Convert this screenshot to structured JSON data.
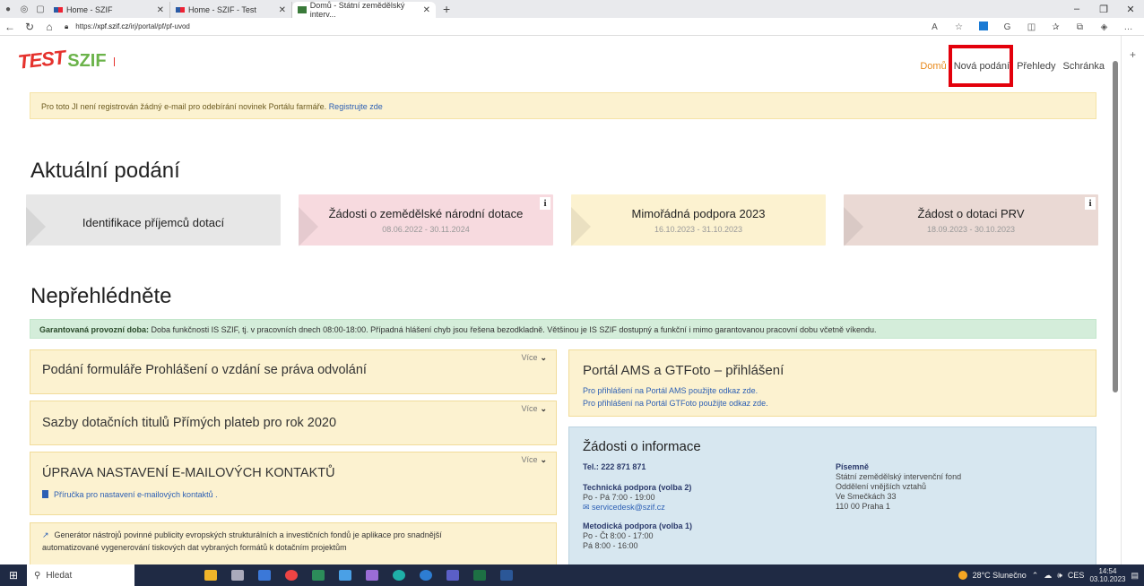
{
  "browser": {
    "tabs": [
      {
        "label": "Home - SZIF"
      },
      {
        "label": "Home - SZIF - Test"
      },
      {
        "label": "Domů - Státní zemědělský interv..."
      }
    ],
    "url": "https://",
    "url_host": "xpf.szif.cz",
    "url_path": "/irj/portal/pf/pf-uvod"
  },
  "header": {
    "logo_test": "TEST",
    "logo_szif": "SZIF",
    "nav": [
      {
        "label": "Domů",
        "active": true
      },
      {
        "label": "Nová podání"
      },
      {
        "label": "Přehledy"
      },
      {
        "label": "Schránka"
      }
    ]
  },
  "alert": {
    "text": "Pro toto JI není registrován žádný e-mail pro odebírání novinek Portálu farmáře.",
    "link": "Registrujte zde"
  },
  "aktualni": {
    "title": "Aktuální podání",
    "cards": [
      {
        "title": "Identifikace příjemců dotací",
        "date": "",
        "color": "#e7e7e7",
        "info": false
      },
      {
        "title": "Žádosti o zemědělské národní dotace",
        "date": "08.06.2022 - 30.11.2024",
        "color": "#f7dadf",
        "info": true
      },
      {
        "title": "Mimořádná podpora 2023",
        "date": "16.10.2023 - 31.10.2023",
        "color": "#fcf2d0",
        "info": false
      },
      {
        "title": "Žádost o dotaci PRV",
        "date": "18.09.2023 - 30.10.2023",
        "color": "#ead9d4",
        "info": true
      }
    ]
  },
  "neprehlednete": {
    "title": "Nepřehlédněte",
    "notice_bold": "Garantovaná provozní doba:",
    "notice": "Doba funkčnosti IS SZIF, tj. v pracovních dnech 08:00-18:00. Případná hlášení chyb jsou řešena bezodkladně. Většinou je IS SZIF dostupný a funkční i mimo garantovanou pracovní dobu včetně víkendu.",
    "more": "Více",
    "box1": "Podání formuláře Prohlášení o vzdání se práva odvolání",
    "box2": "Sazby dotačních titulů Přímých plateb pro rok 2020",
    "box3": "ÚPRAVA NASTAVENÍ E-MAILOVÝCH KONTAKTŮ",
    "box3_link": "Příručka pro nastavení e-mailových kontaktů .",
    "box4_line1": "Generátor nástrojů povinné publicity evropských strukturálních a investičních fondů je aplikace pro snadnější",
    "box4_line2": "automatizované vygenerování tiskových dat vybraných formátů k dotačním projektům",
    "ams_title": "Portál AMS a GTFoto – přihlášení",
    "ams_l1": "Pro přihlášení na Portál AMS použijte odkaz zde.",
    "ams_l2": "Pro přihlášení na Portál GTFoto použijte odkaz zde.",
    "info_title": "Žádosti o informace",
    "tel": "Tel.: 222 871 871",
    "tech_title": "Technická podpora (volba 2)",
    "tech_hours": "Po - Pá 7:00 - 19:00",
    "tech_mail": "servicedesk@szif.cz",
    "met_title": "Metodická podpora (volba 1)",
    "met_h1": "Po - Čt 8:00 - 17:00",
    "met_h2": "Pá 8:00 - 16:00",
    "pis_title": "Písemně",
    "pis_1": "Státní zemědělský intervenční fond",
    "pis_2": "Oddělení vnějších vztahů",
    "pis_3": "Ve Smečkách 33",
    "pis_4": "110 00 Praha 1"
  },
  "taskbar": {
    "search": "Hledat",
    "weather": "28°C Slunečno",
    "lang": "CES",
    "time": "14:54",
    "date": "03.10.2023"
  }
}
